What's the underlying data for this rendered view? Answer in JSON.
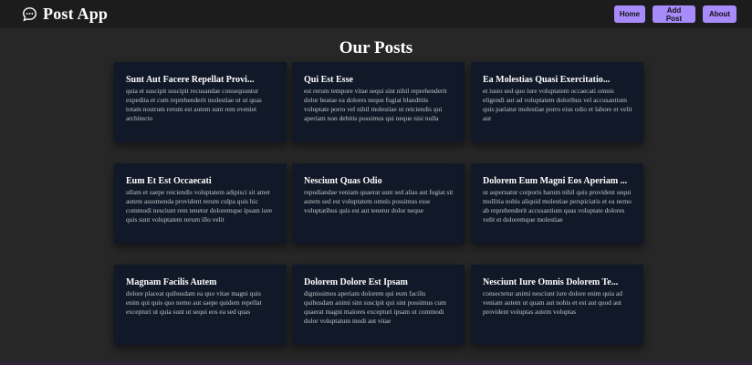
{
  "app": {
    "title": "Post App",
    "brand_icon": "chat-bubble-icon"
  },
  "nav": {
    "buttons": [
      "Home",
      "Add Post",
      "About"
    ],
    "button_color": "#a78bfa"
  },
  "page": {
    "heading": "Our Posts"
  },
  "posts": [
    {
      "title": "Sunt Aut Facere Repellat Provi...",
      "body": "quia et suscipit suscipit recusandae consequuntur expedita et cum reprehenderit molestiae ut ut quas totam nostrum rerum est autem sunt rem eveniet architecto"
    },
    {
      "title": "Qui Est Esse",
      "body": "est rerum tempore vitae sequi sint nihil reprehenderit dolor beatae ea dolores neque fugiat blanditiis voluptate porro vel nihil molestiae ut reiciendis qui aperiam non debitis possimus qui neque nisi nulla"
    },
    {
      "title": "Ea Molestias Quasi Exercitatio...",
      "body": "et iusto sed quo iure voluptatem occaecati omnis eligendi aut ad voluptatem doloribus vel accusantium quis pariatur molestiae porro eius odio et labore et velit aut"
    },
    {
      "title": "Eum Et Est Occaecati",
      "body": "ullam et saepe reiciendis voluptatem adipisci sit amet autem assumenda provident rerum culpa quis hic commodi nesciunt rem tenetur doloremque ipsam iure quis sunt voluptatem rerum illo velit"
    },
    {
      "title": "Nesciunt Quas Odio",
      "body": "repudiandae veniam quaerat sunt sed alias aut fugiat sit autem sed est voluptatem omnis possimus esse voluptatibus quis est aut tenetur dolor neque"
    },
    {
      "title": "Dolorem Eum Magni Eos Aperiam ...",
      "body": "ut aspernatur corporis harum nihil quis provident sequi mollitia nobis aliquid molestiae perspiciatis et ea nemo ab reprehenderit accusantium quas voluptate dolores velit et doloremque molestiae"
    },
    {
      "title": "Magnam Facilis Autem",
      "body": "dolore placeat quibusdam ea quo vitae magni quis enim qui quis quo nemo aut saepe quidem repellat excepturi ut quia sunt ut sequi eos ea sed quas"
    },
    {
      "title": "Dolorem Dolore Est Ipsam",
      "body": "dignissimos aperiam dolorem qui eum facilis quibusdam animi sint suscipit qui sint possimus cum quaerat magni maiores excepturi ipsam ut commodi dolor voluptatum modi aut vitae"
    },
    {
      "title": "Nesciunt Iure Omnis Dolorem Te...",
      "body": "consectetur animi nesciunt iure dolore enim quia ad veniam autem ut quam aut nobis et est aut quod aut provident voluptas autem voluptas"
    }
  ]
}
